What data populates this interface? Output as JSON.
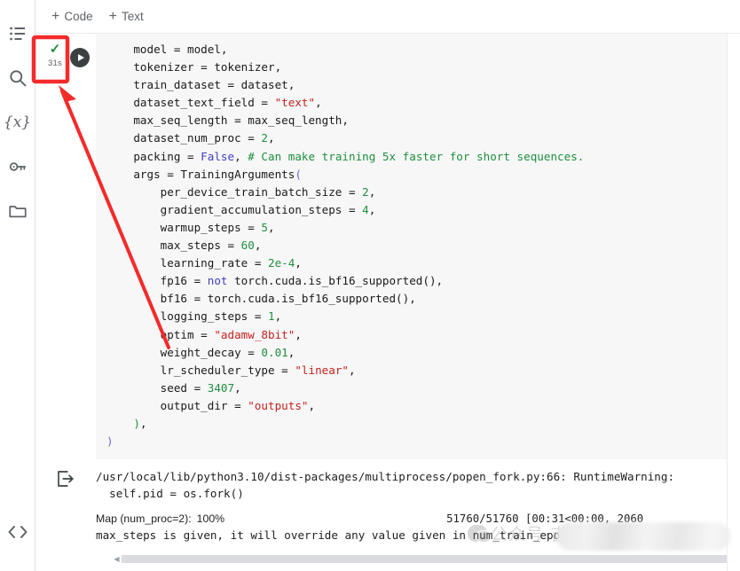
{
  "toolbar": {
    "add_code_label": "Code",
    "add_text_label": "Text",
    "plus_glyph": "+"
  },
  "sidebar": {
    "items": [
      {
        "name": "table-of-contents-icon",
        "label": "Table of contents"
      },
      {
        "name": "search-icon",
        "label": "Find and replace"
      },
      {
        "name": "variables-icon",
        "label": "{x}"
      },
      {
        "name": "secrets-key-icon",
        "label": "Secrets"
      },
      {
        "name": "files-folder-icon",
        "label": "Files"
      }
    ],
    "bottom_item": {
      "name": "code-snippets-icon",
      "label": "<>"
    }
  },
  "cell": {
    "status_check": "✓",
    "run_time": "31s",
    "play_label": "Run cell",
    "code_lines": [
      {
        "indent": 4,
        "tokens": [
          {
            "t": "model = model,",
            "c": "k-var"
          }
        ]
      },
      {
        "indent": 4,
        "tokens": [
          {
            "t": "tokenizer = tokenizer,",
            "c": "k-var"
          }
        ]
      },
      {
        "indent": 4,
        "tokens": [
          {
            "t": "train_dataset = dataset,",
            "c": "k-var"
          }
        ]
      },
      {
        "indent": 4,
        "tokens": [
          {
            "t": "dataset_text_field = ",
            "c": "k-var"
          },
          {
            "t": "\"text\"",
            "c": "k-str"
          },
          {
            "t": ",",
            "c": "k-var"
          }
        ]
      },
      {
        "indent": 4,
        "tokens": [
          {
            "t": "max_seq_length = max_seq_length,",
            "c": "k-var"
          }
        ]
      },
      {
        "indent": 4,
        "tokens": [
          {
            "t": "dataset_num_proc = ",
            "c": "k-var"
          },
          {
            "t": "2",
            "c": "k-num"
          },
          {
            "t": ",",
            "c": "k-var"
          }
        ]
      },
      {
        "indent": 4,
        "tokens": [
          {
            "t": "packing = ",
            "c": "k-var"
          },
          {
            "t": "False",
            "c": "k-kw"
          },
          {
            "t": ", ",
            "c": "k-var"
          },
          {
            "t": "# Can make training 5x faster for short sequences.",
            "c": "k-com"
          }
        ]
      },
      {
        "indent": 4,
        "tokens": [
          {
            "t": "args = TrainingArguments",
            "c": "k-var"
          },
          {
            "t": "(",
            "c": "k-paren"
          }
        ]
      },
      {
        "indent": 8,
        "tokens": [
          {
            "t": "per_device_train_batch_size = ",
            "c": "k-var"
          },
          {
            "t": "2",
            "c": "k-num"
          },
          {
            "t": ",",
            "c": "k-var"
          }
        ]
      },
      {
        "indent": 8,
        "tokens": [
          {
            "t": "gradient_accumulation_steps = ",
            "c": "k-var"
          },
          {
            "t": "4",
            "c": "k-num"
          },
          {
            "t": ",",
            "c": "k-var"
          }
        ]
      },
      {
        "indent": 8,
        "tokens": [
          {
            "t": "warmup_steps = ",
            "c": "k-var"
          },
          {
            "t": "5",
            "c": "k-num"
          },
          {
            "t": ",",
            "c": "k-var"
          }
        ]
      },
      {
        "indent": 8,
        "tokens": [
          {
            "t": "max_steps = ",
            "c": "k-var"
          },
          {
            "t": "60",
            "c": "k-num"
          },
          {
            "t": ",",
            "c": "k-var"
          }
        ]
      },
      {
        "indent": 8,
        "tokens": [
          {
            "t": "learning_rate = ",
            "c": "k-var"
          },
          {
            "t": "2e-4",
            "c": "k-num"
          },
          {
            "t": ",",
            "c": "k-var"
          }
        ]
      },
      {
        "indent": 8,
        "tokens": [
          {
            "t": "fp16 = ",
            "c": "k-var"
          },
          {
            "t": "not",
            "c": "k-kw"
          },
          {
            "t": " torch.cuda.is_bf16_supported(),",
            "c": "k-var"
          }
        ]
      },
      {
        "indent": 8,
        "tokens": [
          {
            "t": "bf16 = torch.cuda.is_bf16_supported(),",
            "c": "k-var"
          }
        ]
      },
      {
        "indent": 8,
        "tokens": [
          {
            "t": "logging_steps = ",
            "c": "k-var"
          },
          {
            "t": "1",
            "c": "k-num"
          },
          {
            "t": ",",
            "c": "k-var"
          }
        ]
      },
      {
        "indent": 8,
        "tokens": [
          {
            "t": "optim = ",
            "c": "k-var"
          },
          {
            "t": "\"adamw_8bit\"",
            "c": "k-str"
          },
          {
            "t": ",",
            "c": "k-var"
          }
        ]
      },
      {
        "indent": 8,
        "tokens": [
          {
            "t": "weight_decay = ",
            "c": "k-var"
          },
          {
            "t": "0.01",
            "c": "k-num"
          },
          {
            "t": ",",
            "c": "k-var"
          }
        ]
      },
      {
        "indent": 8,
        "tokens": [
          {
            "t": "lr_scheduler_type = ",
            "c": "k-var"
          },
          {
            "t": "\"linear\"",
            "c": "k-str"
          },
          {
            "t": ",",
            "c": "k-var"
          }
        ]
      },
      {
        "indent": 8,
        "tokens": [
          {
            "t": "seed = ",
            "c": "k-var"
          },
          {
            "t": "3407",
            "c": "k-num"
          },
          {
            "t": ",",
            "c": "k-var"
          }
        ]
      },
      {
        "indent": 8,
        "tokens": [
          {
            "t": "output_dir = ",
            "c": "k-var"
          },
          {
            "t": "\"outputs\"",
            "c": "k-str"
          },
          {
            "t": ",",
            "c": "k-var"
          }
        ]
      },
      {
        "indent": 4,
        "tokens": [
          {
            "t": ")",
            "c": "k-num"
          },
          {
            "t": ",",
            "c": "k-var"
          }
        ]
      },
      {
        "indent": 0,
        "tokens": [
          {
            "t": ")",
            "c": "k-paren"
          }
        ]
      }
    ]
  },
  "output": {
    "icon_name": "output-arrow-icon",
    "warning_line1": "/usr/local/lib/python3.10/dist-packages/multiprocess/popen_fork.py:66: RuntimeWarning: ",
    "warning_line2": "  self.pid = os.fork()",
    "progress": {
      "label": "Map (num_proc=2):",
      "percent": "100%",
      "percent_value": 100,
      "count": "51760/51760 [00:31<00:00, 2060",
      "bar_color": "#43a047"
    },
    "final_line": "max_steps is given, it will override any value given in num_train_epochs"
  },
  "watermark": {
    "text": "公众号·吉哒",
    "logo_name": "wechat-logo-icon"
  },
  "annotations": {
    "highlight_box_color": "#f42b2b",
    "arrow_color": "#f42b2b",
    "highlight_target": "cell-run-status"
  },
  "scrollbar": {
    "left_arrow_glyph": "◀"
  }
}
